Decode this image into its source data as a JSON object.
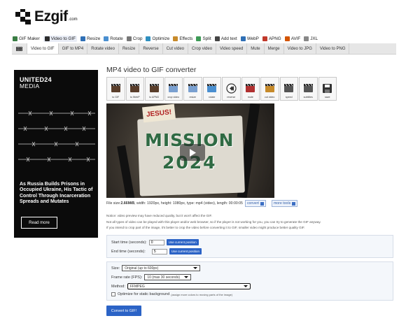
{
  "logo": {
    "text": "Ezgif",
    "tld": ".com"
  },
  "main_nav": [
    {
      "label": "GIF Maker",
      "icon": "gif-maker-icon",
      "color": "#3a7d44"
    },
    {
      "label": "Video to GIF",
      "icon": "video-icon",
      "color": "#2c2c2c",
      "active": true
    },
    {
      "label": "Resize",
      "icon": "resize-icon",
      "color": "#2f6fb5"
    },
    {
      "label": "Rotate",
      "icon": "rotate-icon",
      "color": "#4a8fd0"
    },
    {
      "label": "Crop",
      "icon": "crop-icon",
      "color": "#777777"
    },
    {
      "label": "Optimize",
      "icon": "optimize-icon",
      "color": "#2f8fbf"
    },
    {
      "label": "Effects",
      "icon": "effects-icon",
      "color": "#c78a2a"
    },
    {
      "label": "Split",
      "icon": "split-icon",
      "color": "#3d9a56"
    },
    {
      "label": "Add text",
      "icon": "add-text-icon",
      "color": "#444444"
    },
    {
      "label": "WebP",
      "icon": "webp-icon",
      "color": "#2f6fb5"
    },
    {
      "label": "APNG",
      "icon": "apng-icon",
      "color": "#c0392b"
    },
    {
      "label": "AVIF",
      "icon": "avif-icon",
      "color": "#d35400"
    },
    {
      "label": "JXL",
      "icon": "jxl-icon",
      "color": "#888888"
    }
  ],
  "sub_nav": [
    {
      "label": "Video to GIF",
      "active": true
    },
    {
      "label": "GIF to MP4"
    },
    {
      "label": "Rotate video"
    },
    {
      "label": "Resize"
    },
    {
      "label": "Reverse"
    },
    {
      "label": "Cut video"
    },
    {
      "label": "Crop video"
    },
    {
      "label": "Video speed"
    },
    {
      "label": "Mute"
    },
    {
      "label": "Merge"
    },
    {
      "label": "Video to JPG"
    },
    {
      "label": "Video to PNG"
    }
  ],
  "ad": {
    "brand_line1": "UNITED24",
    "brand_line2": "MEDIA",
    "headline": "As Russia Builds Prisons in Occupied Ukraine, His Tactic of Control Through Incarceration Spreads and Mutates",
    "button": "Read more"
  },
  "converter": {
    "title": "MP4 video to GIF converter",
    "tools": [
      {
        "label": "to GIF",
        "icon": "to-gif-icon"
      },
      {
        "label": "to WebP",
        "icon": "to-webp-icon"
      },
      {
        "label": "to APNG",
        "icon": "to-apng-icon"
      },
      {
        "label": "crop video",
        "icon": "crop-video-icon"
      },
      {
        "label": "resize",
        "icon": "resize-video-icon"
      },
      {
        "label": "rotate",
        "icon": "rotate-video-icon"
      },
      {
        "label": "reverse",
        "icon": "reverse-icon"
      },
      {
        "label": "mute",
        "icon": "mute-icon"
      },
      {
        "label": "cut video",
        "icon": "cut-video-icon"
      },
      {
        "label": "speed",
        "icon": "speed-icon"
      },
      {
        "label": "subtitles",
        "icon": "subtitles-icon"
      },
      {
        "label": "save",
        "icon": "save-icon"
      }
    ],
    "video": {
      "jesus_text": "JESUS!",
      "title_line1": "MISSION",
      "title_line2": "2024"
    },
    "file_info": {
      "label": "File size: ",
      "size": "2.66MiB",
      "rest": ", width: 1920px, height: 1080px, type: mp4 (video), length: 00:00:05",
      "convert_label": "convert",
      "more_tools_label": "more tools"
    },
    "notice": [
      "Notice: video preview may have reduced quality, but it won't affect the GIF.",
      "Not all types of video can be played with this player and/or web browser, so if the player is not working for you, you can try to generate the GIF anyway.",
      "If you intend to crop part of the image, it's better to crop the video before converting it to GIF, smaller video might produce better quality GIF."
    ],
    "start_time": {
      "label": "Start time (seconds):",
      "value": "0",
      "button": "Use current position"
    },
    "end_time": {
      "label": "End time (seconds):",
      "value": "5",
      "button": "Use current position"
    },
    "size": {
      "label": "Size:",
      "value": "Original (up to 600px)"
    },
    "frame_rate": {
      "label": "Frame rate (FPS):",
      "value": "10 (max 30 seconds)"
    },
    "method": {
      "label": "Method:",
      "value": "FFMPEG"
    },
    "static_bg": {
      "label": "Optimize for static background",
      "note": "(assign more colors to moving parts of the image)"
    },
    "convert_button": "Convert to GIF!"
  }
}
